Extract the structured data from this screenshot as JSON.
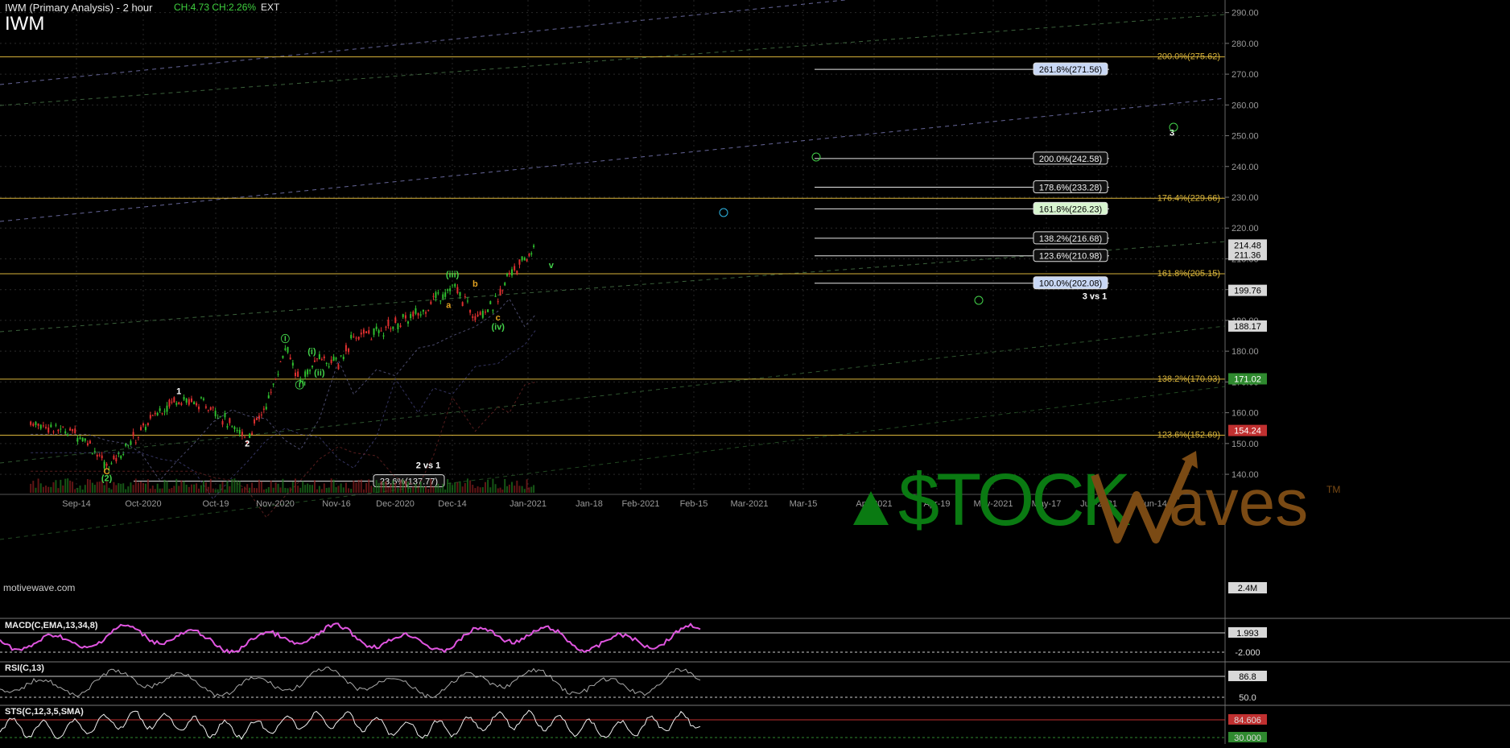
{
  "header": {
    "title": "IWM (Primary Analysis) - 2 hour",
    "change": "CH:4.73  CH:2.26%",
    "ext": "EXT",
    "symbol": "IWM"
  },
  "watermark": "motivewave.com",
  "logo": {
    "text": "$TOCKWaves",
    "brand_green": "#0a7a12",
    "brand_brown": "#7a4a14"
  },
  "colors": {
    "up": "#2fbf2f",
    "down": "#e03030",
    "fib_orange": "#d9b43a",
    "wave_green": "#43d24a",
    "wave_cyan": "#2fb8e6"
  },
  "chart_data": {
    "type": "line",
    "title": "IWM (Primary Analysis) - 2 hour",
    "xlabel": "",
    "ylabel": "",
    "ylim": [
      134,
      292
    ],
    "x_ticks": [
      "Sep-14",
      "Oct-2020",
      "Oct-19",
      "Nov-2020",
      "Nov-16",
      "Dec-2020",
      "Dec-14",
      "Jan-2021",
      "Jan-18",
      "Feb-2021",
      "Feb-15",
      "Mar-2021",
      "Mar-15",
      "Apr-2021",
      "Apr-19",
      "May-2021",
      "May-17",
      "Jun-2021",
      "Jun-14"
    ],
    "y_ticks": [
      140,
      150,
      160,
      170,
      180,
      190,
      200,
      210,
      220,
      230,
      240,
      250,
      260,
      270,
      280,
      290
    ],
    "y_tick_labels": [
      "140.00",
      "150.00",
      "160.00",
      "170.00",
      "180.00",
      "190.00",
      "200.00",
      "210.00",
      "220.00",
      "230.00",
      "240.00",
      "250.00",
      "260.00",
      "270.00",
      "280.00",
      "290.00"
    ],
    "price_series": {
      "name": "IWM",
      "x": [
        "Sep-03",
        "Sep-09",
        "Sep-14",
        "Sep-18",
        "Sep-23",
        "Sep-28",
        "Oct-02",
        "Oct-07",
        "Oct-12",
        "Oct-16",
        "Oct-21",
        "Oct-26",
        "Oct-30",
        "Nov-04",
        "Nov-09",
        "Nov-13",
        "Nov-18",
        "Nov-23",
        "Nov-27",
        "Dec-03",
        "Dec-08",
        "Dec-14",
        "Dec-18",
        "Dec-23",
        "Dec-29",
        "Jan-04",
        "Jan-07",
        "Jan-11",
        "Jan-14"
      ],
      "y": [
        157,
        155,
        154,
        151,
        142,
        149,
        154,
        161,
        165,
        163,
        162,
        155,
        152,
        162,
        181,
        170,
        178,
        176,
        185,
        186,
        189,
        192,
        197,
        201,
        192,
        196,
        206,
        209,
        215
      ]
    },
    "right_price_labels": [
      {
        "label": "214.48",
        "value": 214.48
      },
      {
        "label": "211.36",
        "value": 211.36
      },
      {
        "label": "199.76",
        "value": 199.76
      },
      {
        "label": "188.17",
        "value": 188.17
      },
      {
        "label": "171.02",
        "value": 171.02
      },
      {
        "label": "154.24",
        "value": 154.24
      },
      {
        "label": "2.4M",
        "value": 0
      }
    ],
    "fib_horizontals": [
      {
        "label": "200.0%(275.62)",
        "value": 275.62
      },
      {
        "label": "176.4%(229.66)",
        "value": 229.66
      },
      {
        "label": "161.8%(205.15)",
        "value": 205.15
      },
      {
        "label": "138.2%(170.93)",
        "value": 170.93
      },
      {
        "label": "123.6%(152.69)",
        "value": 152.69
      }
    ],
    "fib_projections": [
      {
        "label": "261.8%(271.56)",
        "value": 271.56
      },
      {
        "label": "200.0%(242.58)",
        "value": 242.58
      },
      {
        "label": "178.6%(233.28)",
        "value": 233.28
      },
      {
        "label": "161.8%(226.23)",
        "value": 226.23
      },
      {
        "label": "138.2%(216.68)",
        "value": 216.68
      },
      {
        "label": "123.6%(210.98)",
        "value": 210.98
      },
      {
        "label": "100.0%(202.08)",
        "value": 202.08
      }
    ],
    "fib_projections_caption": "3 vs 1",
    "retrace": {
      "label": "23.6%(137.77)",
      "value": 137.77,
      "caption": "2 vs 1"
    },
    "wave_labels": [
      {
        "label": "1",
        "x": "Oct-12",
        "y": 166
      },
      {
        "label": "2",
        "x": "Oct-30",
        "y": 149
      },
      {
        "label": "C",
        "x": "Sep-23",
        "y": 140
      },
      {
        "label": "(2)",
        "x": "Sep-23",
        "y": 137.8
      },
      {
        "label": "Ⓘ",
        "x": "Nov-09",
        "y": 183
      },
      {
        "label": "Ⓘⁱ",
        "x": "Nov-13",
        "y": 168
      },
      {
        "label": "(i)",
        "x": "Nov-16",
        "y": 179
      },
      {
        "label": "(ii)",
        "x": "Nov-18",
        "y": 172
      },
      {
        "label": "(iii)",
        "x": "Dec-23",
        "y": 204
      },
      {
        "label": "a",
        "x": "Dec-22",
        "y": 194
      },
      {
        "label": "b",
        "x": "Dec-29",
        "y": 201
      },
      {
        "label": "c",
        "x": "Jan-04",
        "y": 190
      },
      {
        "label": "(iv)",
        "x": "Jan-04",
        "y": 187
      },
      {
        "label": "3",
        "x": "May-2021",
        "y": 250
      },
      {
        "label": "v",
        "x": "Jan-18",
        "y": 207
      }
    ],
    "volume_label": "2.4M",
    "indicators": [
      {
        "name": "MACD(C,EMA,13,34,8)",
        "labels": [
          "1.993",
          "-2.000"
        ],
        "values": [
          1.993,
          -2.0
        ]
      },
      {
        "name": "RSI(C,13)",
        "labels": [
          "86.8",
          "50.0"
        ],
        "values": [
          86.8,
          50.0
        ]
      },
      {
        "name": "STS(C,12,3,5,SMA)",
        "labels": [
          "84.606",
          "30.000"
        ],
        "values": [
          84.606,
          30.0
        ]
      }
    ]
  }
}
